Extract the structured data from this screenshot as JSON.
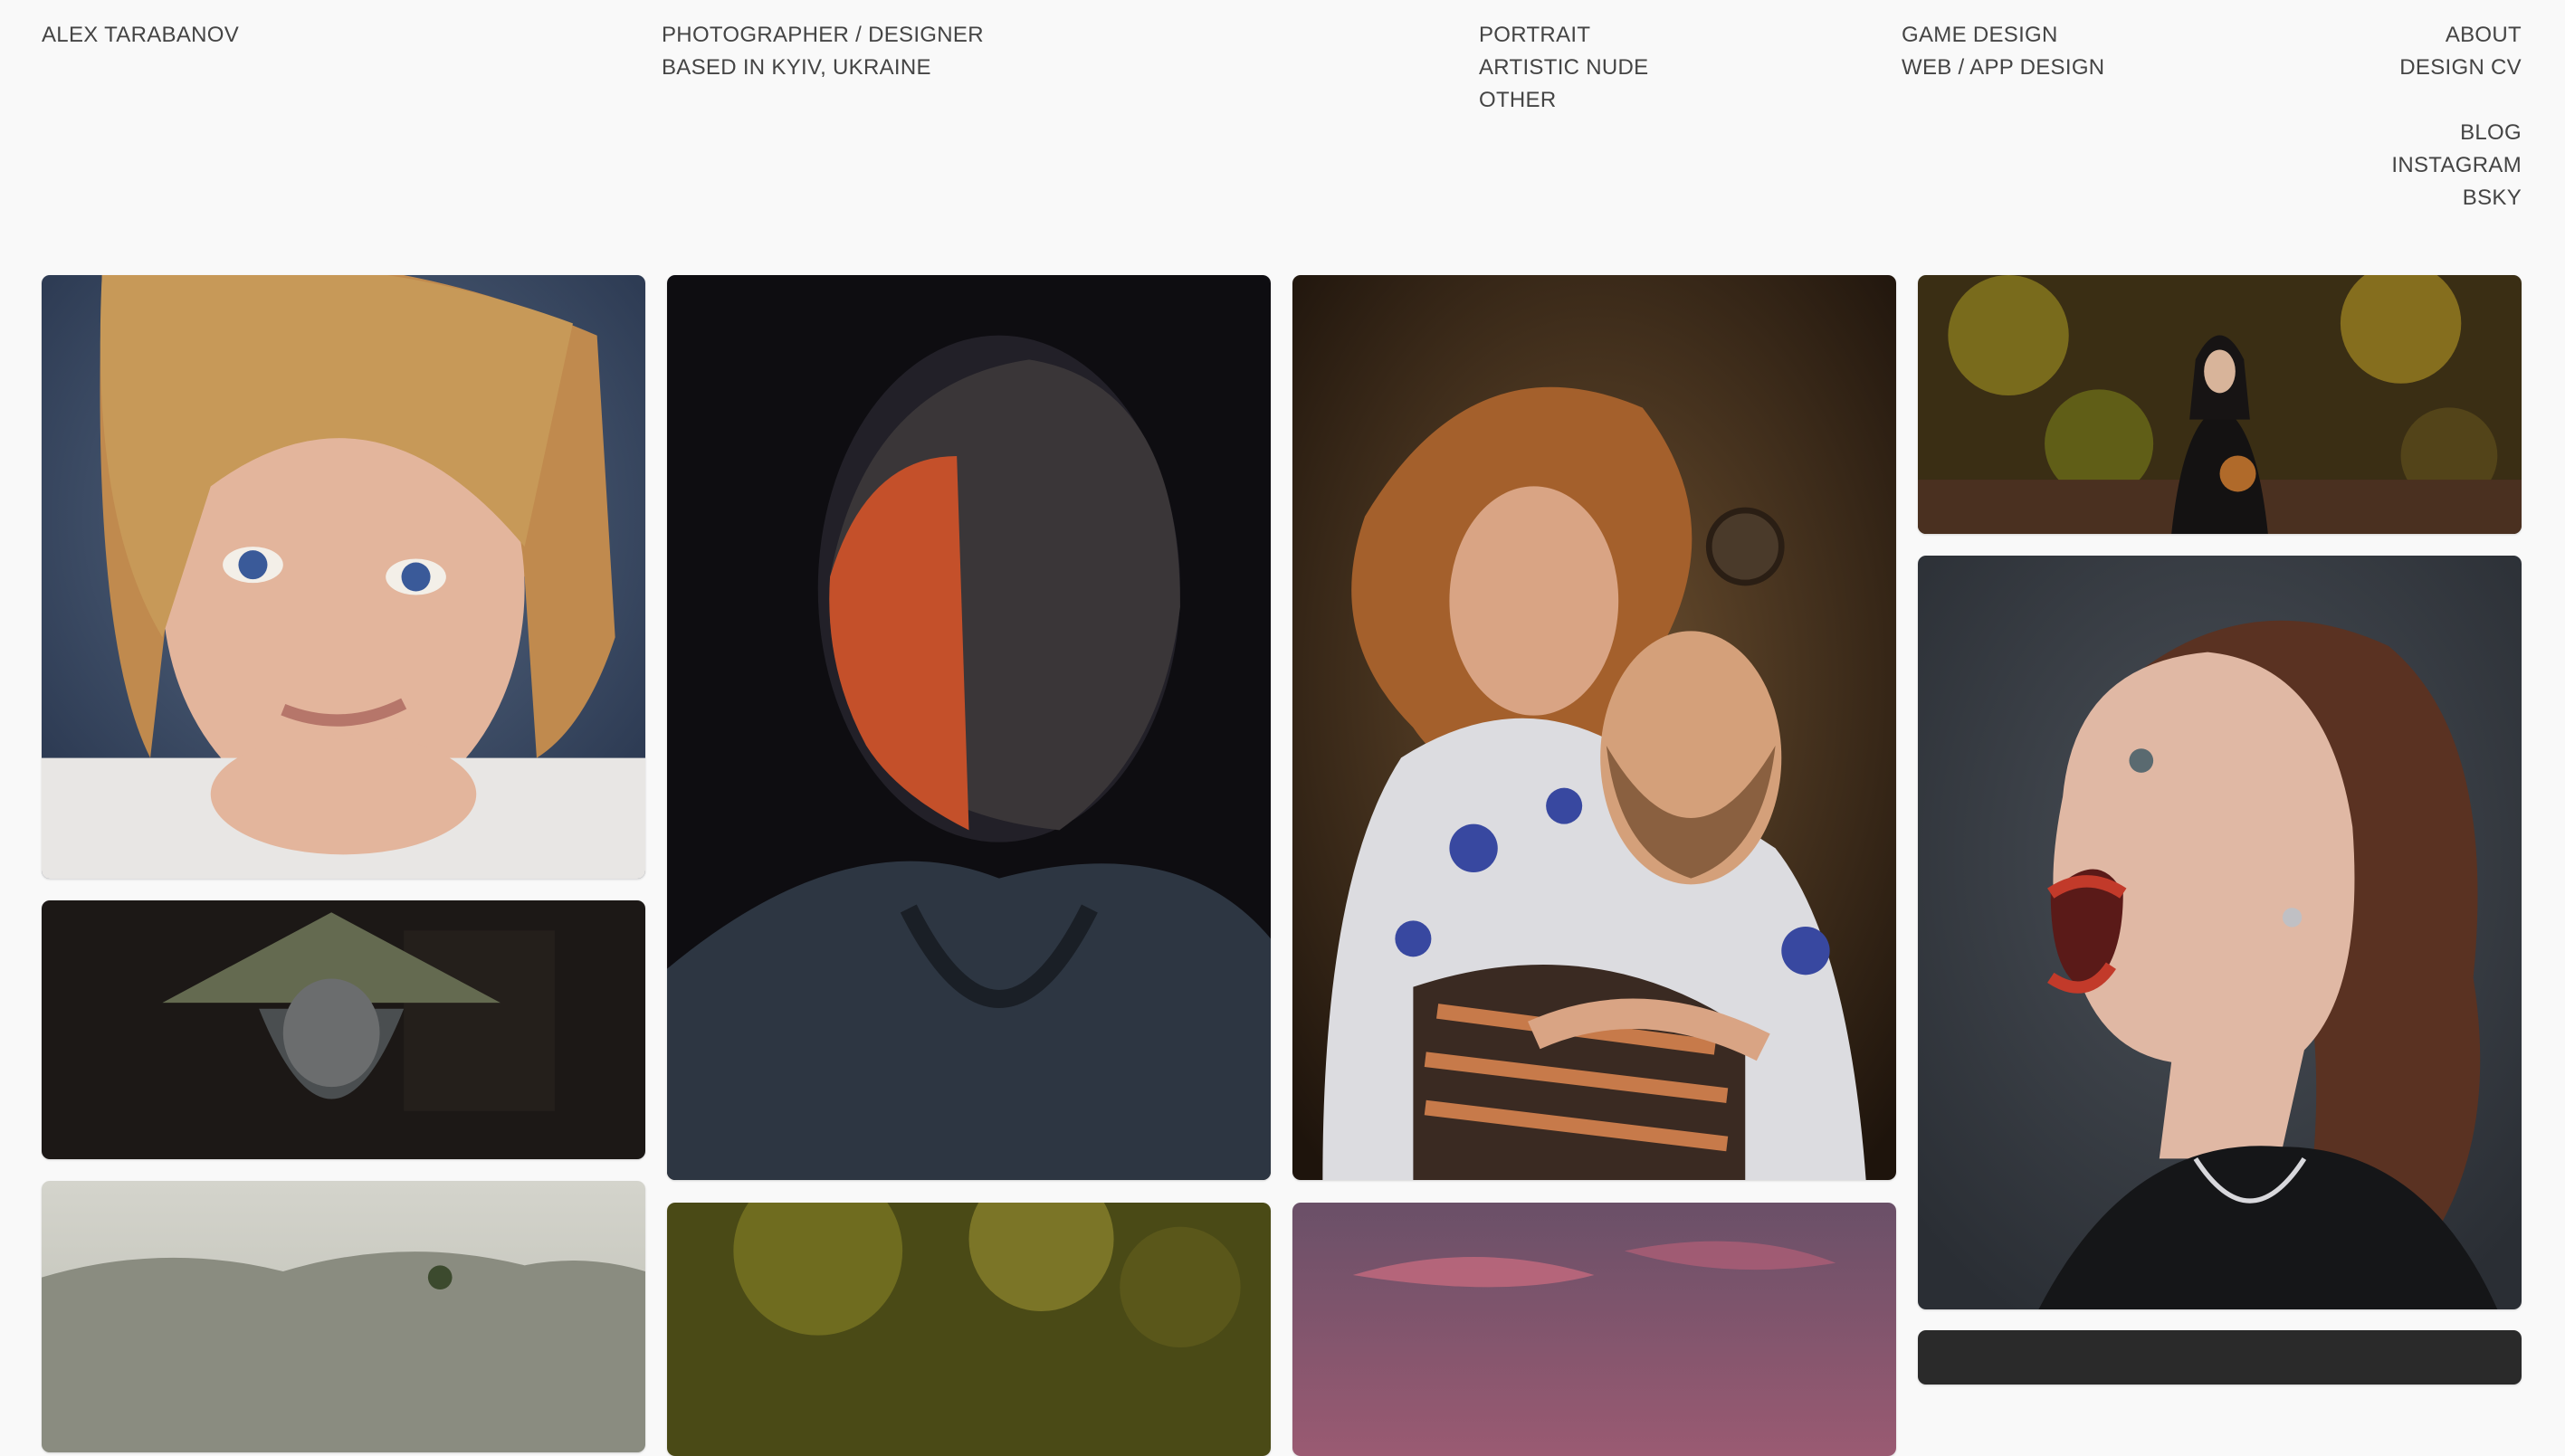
{
  "site": {
    "name": "ALEX TARABANOV",
    "tagline": [
      "PHOTOGRAPHER / DESIGNER",
      "BASED IN KYIV, UKRAINE"
    ]
  },
  "nav": {
    "photo": [
      "PORTRAIT",
      "ARTISTIC NUDE",
      "OTHER"
    ],
    "design": [
      "GAME DESIGN",
      "WEB / APP DESIGN"
    ],
    "info": [
      "ABOUT",
      "DESIGN CV"
    ],
    "social": [
      "BLOG",
      "INSTAGRAM",
      "BSKY"
    ]
  },
  "gallery": {
    "photos": [
      {
        "subject": "woman-blue-eyes-portrait"
      },
      {
        "subject": "woman-straw-hat-portrait"
      },
      {
        "subject": "misty-mountain-landscape"
      },
      {
        "subject": "man-red-light-portrait"
      },
      {
        "subject": "green-bokeh-photo"
      },
      {
        "subject": "couple-embrace-portrait"
      },
      {
        "subject": "pink-sky-photo"
      },
      {
        "subject": "woman-autumn-forest-portrait"
      },
      {
        "subject": "woman-screaming-profile-portrait"
      }
    ]
  },
  "colors": {
    "background": "#f9f9f9",
    "text": "#444444"
  }
}
